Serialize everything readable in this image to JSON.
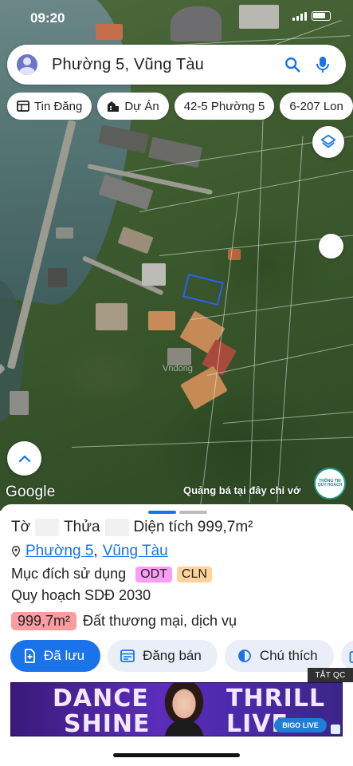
{
  "status_bar": {
    "time": "09:20"
  },
  "search": {
    "query": "Phường 5, Vũng Tàu"
  },
  "chips": [
    {
      "label": "Tin Đăng",
      "icon": "listing-icon"
    },
    {
      "label": "Dự Án",
      "icon": "building-icon"
    },
    {
      "label": "42-5 Phường 5",
      "icon": ""
    },
    {
      "label": "6-207 Lon",
      "icon": ""
    }
  ],
  "map": {
    "attribution": "Google",
    "promo_text": "Quảng bá tại đây chỉ vớ",
    "watermark": "Vndong",
    "info_badge": [
      "THÔNG TIN",
      "QUY HOẠCH"
    ]
  },
  "sheet": {
    "to_label": "Tờ",
    "thua_label": "Thửa",
    "area_label": "Diện tích 999,7m²",
    "ward_link": "Phường 5",
    "separator": ",",
    "city_link": "Vũng Tàu",
    "purpose_label": "Mục đích sử dụng",
    "tags": [
      {
        "label": "ODT",
        "color": "#fb9cf7"
      },
      {
        "label": "CLN",
        "color": "#ffd39a"
      }
    ],
    "plan_label": "Quy hoạch SDĐ 2030",
    "plan_area": "999,7m²",
    "plan_area_color": "#fa9da0",
    "plan_use": "Đất thương mại, dịch vụ"
  },
  "actions": [
    {
      "label": "Đã lưu",
      "icon": "bookmark-add-icon",
      "primary": true
    },
    {
      "label": "Đăng bán",
      "icon": "listing-icon",
      "primary": false
    },
    {
      "label": "Chú thích",
      "icon": "legend-icon",
      "primary": false
    },
    {
      "label": "",
      "icon": "camera-icon",
      "primary": false
    }
  ],
  "ad": {
    "close_label": "TẮT QC",
    "words": [
      "DANCE",
      "THRILL",
      "SHINE",
      "LIVE"
    ],
    "brand": "BIGO LIVE"
  },
  "colors": {
    "accent": "#1a73e8"
  }
}
